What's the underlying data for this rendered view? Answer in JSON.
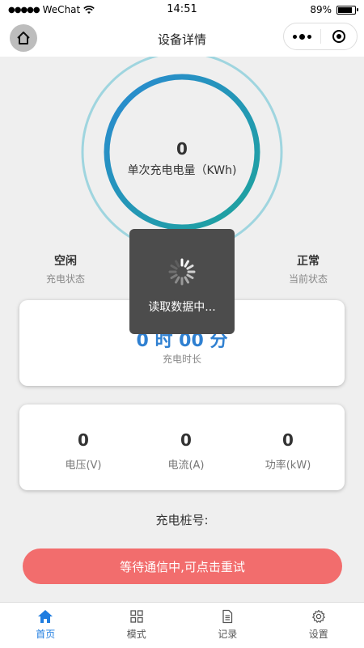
{
  "status_bar": {
    "carrier": "WeChat",
    "time": "14:51",
    "battery": "89%",
    "battery_level": 0.89
  },
  "nav": {
    "title": "设备详情"
  },
  "gauge": {
    "value": "0",
    "label": "单次充电电量（KWh)"
  },
  "charge_status": {
    "value": "空闲",
    "label": "充电状态"
  },
  "current_status": {
    "value": "正常",
    "label": "当前状态"
  },
  "duration": {
    "value": "0 时 00 分",
    "label": "充电时长"
  },
  "metrics": [
    {
      "value": "0",
      "label": "电压(V)"
    },
    {
      "value": "0",
      "label": "电流(A)"
    },
    {
      "value": "0",
      "label": "功率(kW)"
    }
  ],
  "pile_number_label": "充电桩号:",
  "retry_button": "等待通信中,可点击重试",
  "toast": {
    "text": "读取数据中..."
  },
  "tabs": [
    {
      "label": "首页",
      "icon": "home-icon",
      "active": true
    },
    {
      "label": "模式",
      "icon": "grid-icon",
      "active": false
    },
    {
      "label": "记录",
      "icon": "document-icon",
      "active": false
    },
    {
      "label": "设置",
      "icon": "gear-icon",
      "active": false
    }
  ],
  "colors": {
    "accent": "#1f7de0",
    "retry": "#f26d6d",
    "gauge_blue": "#2a8ad2",
    "gauge_teal": "#1ea39c"
  }
}
